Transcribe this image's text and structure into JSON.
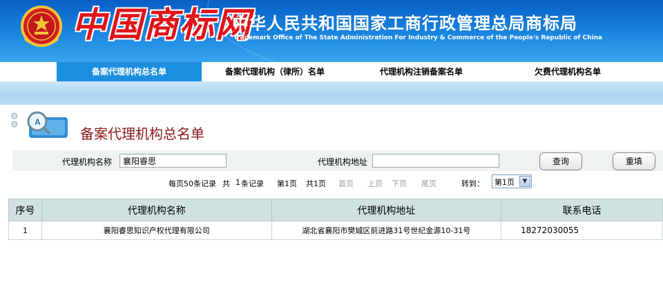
{
  "header": {
    "logo_text": "中国商标网",
    "title_cn": "中华人民共和国国家工商行政管理总局商标局",
    "title_en": "Trademark Office of The State Administration For Industry & Commerce of the People's Republic of China"
  },
  "nav": {
    "items": [
      {
        "label": "备案代理机构总名单",
        "active": true
      },
      {
        "label": "备案代理机构（律所）名单",
        "active": false
      },
      {
        "label": "代理机构注销备案名单",
        "active": false
      },
      {
        "label": "欠费代理机构名单",
        "active": false
      }
    ]
  },
  "page": {
    "title": "备案代理机构总名单"
  },
  "search": {
    "name_label": "代理机构名称",
    "name_value": "襄阳睿思",
    "address_label": "代理机构地址",
    "address_value": "",
    "query_button": "查询",
    "reset_button": "重填"
  },
  "pager": {
    "per_page_text": "每页50条记录",
    "total_prefix": "共",
    "total_count": "1",
    "total_suffix": "条记录",
    "current_page": "第1页",
    "total_pages": "共1页",
    "first": "首页",
    "prev": "上页",
    "next": "下页",
    "last": "尾页",
    "goto_label": "转到：",
    "select_value": "第1页"
  },
  "table": {
    "headers": [
      "序号",
      "代理机构名称",
      "代理机构地址",
      "联系电话"
    ],
    "rows": [
      {
        "no": "1",
        "name": "襄阳睿思知识产权代理有限公司",
        "address": "湖北省襄阳市樊城区前进路31号世纪金源10-31号",
        "phone": "18272030055"
      }
    ]
  },
  "colors": {
    "banner": "#1a86df",
    "nav_active": "#1c8fe0",
    "title_red": "#8b1a1a",
    "table_header": "#cfe2df"
  }
}
